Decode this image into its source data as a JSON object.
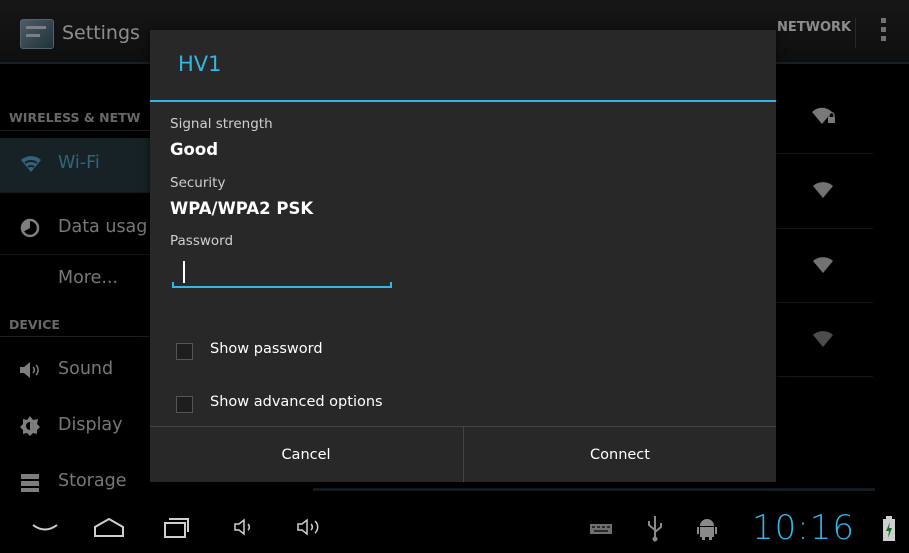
{
  "action_bar": {
    "title": "Settings",
    "add_network_label": "NETWORK"
  },
  "sidebar": {
    "wireless_header": "WIRELESS & NETW",
    "device_header": "DEVICE",
    "items": [
      {
        "label": "Wi-Fi",
        "icon": "wifi-icon",
        "selected": true
      },
      {
        "label": "Data usag",
        "icon": "data-usage-icon"
      },
      {
        "label": "More...",
        "icon": ""
      },
      {
        "label": "Sound",
        "icon": "speaker-icon"
      },
      {
        "label": "Display",
        "icon": "brightness-icon"
      },
      {
        "label": "Storage",
        "icon": "storage-icon"
      }
    ]
  },
  "networks": {
    "icons": [
      "wifi-locked-icon",
      "wifi-icon",
      "wifi-icon",
      "wifi-weak-icon"
    ]
  },
  "dialog": {
    "title": "HV1",
    "signal_label": "Signal strength",
    "signal_value": "Good",
    "security_label": "Security",
    "security_value": "WPA/WPA2 PSK",
    "password_label": "Password",
    "password_value": "",
    "show_password_label": "Show password",
    "show_password_checked": false,
    "show_advanced_label": "Show advanced options",
    "show_advanced_checked": false,
    "cancel_label": "Cancel",
    "connect_label": "Connect"
  },
  "system_bar": {
    "clock": "10:16",
    "icons": [
      "back-icon",
      "home-icon",
      "recent-apps-icon",
      "volume-down-icon",
      "volume-up-icon",
      "keyboard-icon",
      "usb-icon",
      "android-debug-icon",
      "battery-charging-icon"
    ]
  },
  "colors": {
    "accent": "#33b5e5",
    "dialog_bg": "#282828",
    "selected_item_bg": "#2b3e47"
  }
}
